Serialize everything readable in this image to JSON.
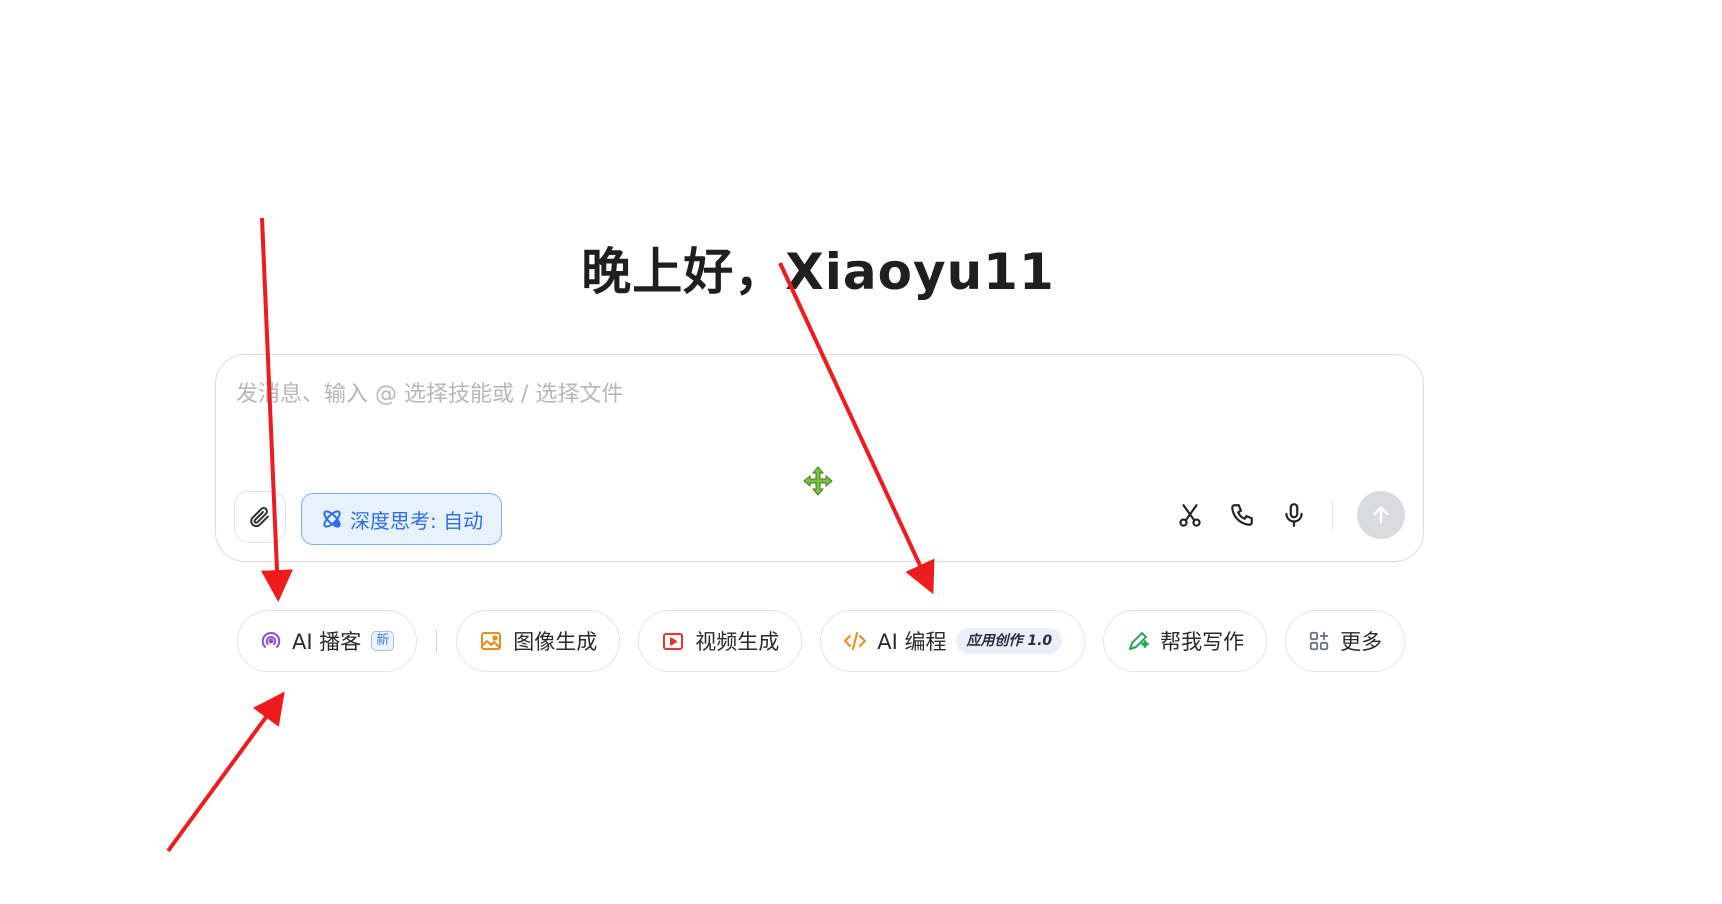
{
  "greeting": "晚上好，Xiaoyu11",
  "composer": {
    "placeholder": "发消息、输入 @ 选择技能或 / 选择文件",
    "deep_think_label": "深度思考: 自动"
  },
  "skills": [
    {
      "label": "AI 播客",
      "badge": "新",
      "icon": "podcast-icon",
      "color": "#8b4fd6"
    },
    {
      "label": "图像生成",
      "icon": "image-icon",
      "color": "#f08a1c"
    },
    {
      "label": "视频生成",
      "icon": "video-icon",
      "color": "#e8352e"
    },
    {
      "label": "AI 编程",
      "badge": "应用创作 1.0",
      "icon": "code-icon",
      "color": "#f08a1c"
    },
    {
      "label": "帮我写作",
      "icon": "pen-icon",
      "color": "#27a85a"
    },
    {
      "label": "更多",
      "icon": "grid-icon",
      "color": "#6b7280"
    }
  ],
  "colors": {
    "accent": "#2d6fe6",
    "annotation_arrow": "#ee1c1c"
  }
}
